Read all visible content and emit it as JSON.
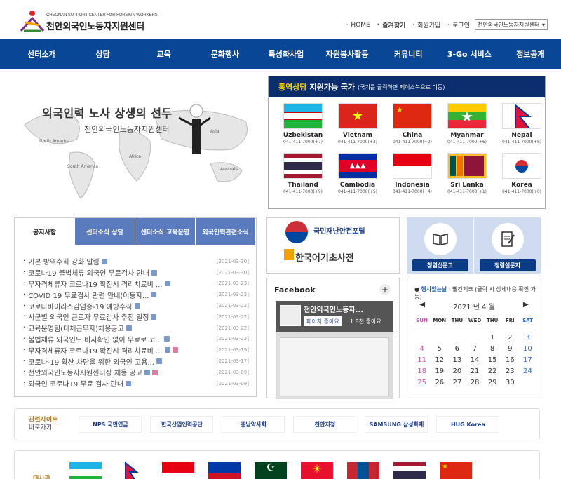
{
  "header": {
    "logo_sub": "CHEONAN SUPPORT CENTER FOR FOREIGN WORKERS",
    "logo_title": "천안외국인노동자지원센터",
    "links": [
      "HOME",
      "즐겨찾기",
      "회원가입",
      "로그인"
    ],
    "select_value": "천안외국인노동자지원센터"
  },
  "nav": [
    "센터소개",
    "상담",
    "교육",
    "문화행사",
    "특성화사업",
    "자원봉사활동",
    "커뮤니티",
    "3-Go 서비스",
    "정보공개"
  ],
  "banner": {
    "title": "외국인력 노사 상생의 선두",
    "subtitle": "천안외국인노동자지원센터",
    "continents": [
      "North America",
      "South America",
      "Africa",
      "Australia",
      "Asia"
    ]
  },
  "countries": {
    "title_hl": "통역상담",
    "title": "지원가능 국가",
    "note": "(국기를 클릭하면 페이스북으로 이동)",
    "items": [
      {
        "name": "Uzbekistan",
        "tel": "041-411-7000(+7)"
      },
      {
        "name": "Vietnam",
        "tel": "041-411-7000(+3)"
      },
      {
        "name": "China",
        "tel": "041-411-7000(+2)"
      },
      {
        "name": "Myanmar",
        "tel": "041-411-7000(+6)"
      },
      {
        "name": "Nepal",
        "tel": "041-411-7000(+8)"
      },
      {
        "name": "Thailand",
        "tel": "041-411-7000(+9)"
      },
      {
        "name": "Cambodia",
        "tel": "041-411-7000(+5)"
      },
      {
        "name": "Indonesia",
        "tel": "041-411-7000(+4)"
      },
      {
        "name": "Sri Lanka",
        "tel": "041-411-7000(+1)"
      },
      {
        "name": "Korea",
        "tel": "041-411-7000(+0)"
      }
    ]
  },
  "notice": {
    "tabs": [
      "공지사항",
      "센터소식 상담",
      "센터소식 교육운영",
      "외국인력관련소식"
    ],
    "rows": [
      {
        "title": "기본 방역수칙 강화 알림",
        "date": "[2021-03-30]",
        "badge": "n"
      },
      {
        "title": "코로나19 불법체류 외국인 무료검사 안내",
        "date": "[2021-03-30]",
        "badge": "n"
      },
      {
        "title": "무자격체류자 코로나19 확진시 격리치료비 ...",
        "date": "[2021-03-23]",
        "badge": "n"
      },
      {
        "title": "COVID 19 무료검사 관련 안내(이동자...",
        "date": "[2021-03-23]",
        "badge": "n"
      },
      {
        "title": "코로나바이러스감염증-19 예방수칙",
        "date": "[2021-03-22]",
        "badge": "n"
      },
      {
        "title": "시군별 외국인 근로자 무료검사 추진 일정",
        "date": "[2021-03-22]",
        "badge": "n"
      },
      {
        "title": "교육운영팀(대체근무자)채용공고",
        "date": "[2021-03-22]",
        "badge": "n"
      },
      {
        "title": "불법체류 외국인도 비자확인 없이 무료로 코...",
        "date": "[2021-03-22]",
        "badge": "n"
      },
      {
        "title": "무자격체류자 코로나19 확진시 격리치료비 ...",
        "date": "[2021-03-19]",
        "badge": "np"
      },
      {
        "title": "코로나-19 확산 차단을 위한 외국인 고용...",
        "date": "[2021-03-17]",
        "badge": "n"
      },
      {
        "title": "천안외국인노동자지원센터장 채용 공고",
        "date": "[2021-03-09]",
        "badge": "np"
      },
      {
        "title": "외국인 코로나19 무료 검사 안내",
        "date": "[2021-03-09]",
        "badge": "n"
      }
    ]
  },
  "disaster": {
    "name": "국민재난안전포털",
    "dict": "한국어기초사전"
  },
  "facebook": {
    "title": "Facebook",
    "page": "천안외국인노동자...",
    "like": "페이지 좋아요",
    "count": "1.8천 좋아요"
  },
  "quick": [
    "청렴신문고",
    "청렴설문지"
  ],
  "calendar": {
    "head_b": "행사있는날",
    "head": ": 빨간체크 (클릭 시 상세내용 확인 가능)",
    "month": "2021 년 4 월",
    "days": [
      "SUN",
      "MON",
      "THU",
      "WED",
      "THU",
      "FRI",
      "SAT"
    ],
    "dates": [
      "",
      "",
      "",
      "",
      "1",
      "2",
      "3",
      "4",
      "5",
      "6",
      "7",
      "8",
      "9",
      "10",
      "11",
      "12",
      "13",
      "14",
      "15",
      "16",
      "17",
      "18",
      "19",
      "20",
      "21",
      "22",
      "23",
      "24",
      "25",
      "26",
      "27",
      "28",
      "29",
      "30",
      ""
    ]
  },
  "related": {
    "title_a": "관련사이트",
    "title_b": "바로가기",
    "sites": [
      "NPS 국민연금",
      "한국산업인력공단",
      "충남약사회",
      "천안지청",
      "SAMSUNG 삼성화재",
      "HUG Korea"
    ]
  },
  "embassy": {
    "title": "대사관"
  },
  "colors": {
    "nav": "#0a4696",
    "panel_head": "#0c2d6b",
    "accent": "#ffd700"
  }
}
